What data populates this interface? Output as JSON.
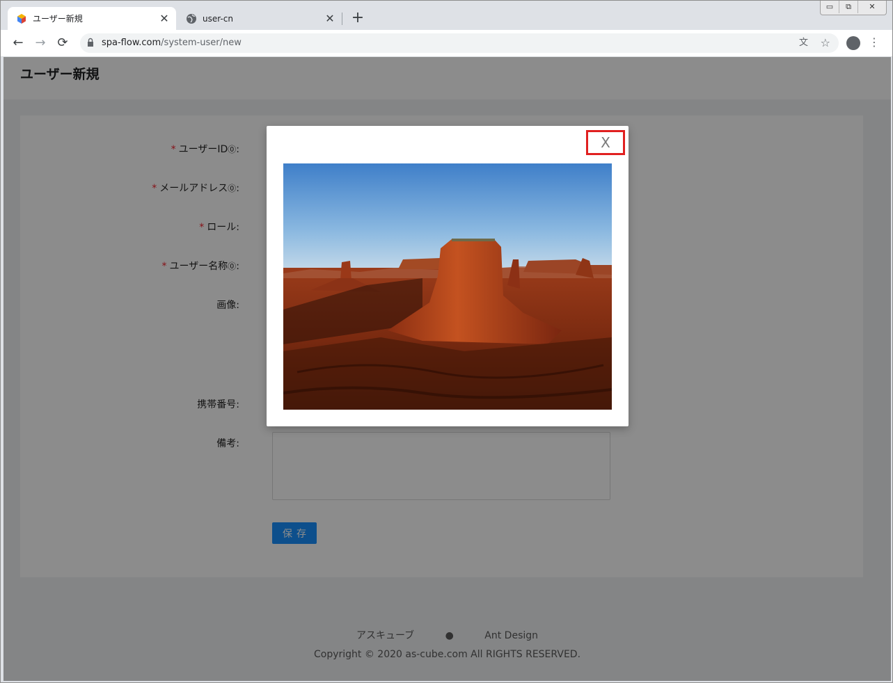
{
  "browser": {
    "tabs": [
      {
        "title": "ユーザー新規",
        "active": true,
        "favicon": "cube-icon"
      },
      {
        "title": "user-cn",
        "active": false,
        "favicon": "globe-icon"
      }
    ],
    "close_glyph": "✕",
    "new_tab_glyph": "+",
    "window_controls": {
      "minimize": "▭",
      "restore": "⧉",
      "close": "✕"
    },
    "nav": {
      "back": "←",
      "forward": "→",
      "reload": "⟳"
    },
    "url": {
      "host": "spa-flow.com",
      "path": "/system-user/new"
    },
    "star_glyph": "☆",
    "translate_glyph": "文",
    "menu_glyph": "⋮"
  },
  "page": {
    "title": "ユーザー新規",
    "form": {
      "fields": [
        {
          "label": "ユーザーID",
          "required": true,
          "help": true
        },
        {
          "label": "メールアドレス",
          "required": true,
          "help": true
        },
        {
          "label": "ロール",
          "required": true,
          "help": false
        },
        {
          "label": "ユーザー名称",
          "required": true,
          "help": true
        },
        {
          "label": "画像",
          "required": false,
          "help": false
        },
        {
          "label": "携帯番号",
          "required": false,
          "help": false
        },
        {
          "label": "備考",
          "required": false,
          "help": false
        }
      ],
      "required_mark": "*",
      "help_mark": "⓪",
      "colon": ":",
      "save_label": "保存"
    },
    "footer": {
      "link1": "アスキューブ",
      "github_glyph": "●",
      "link2": "Ant Design",
      "copyright": "Copyright © 2020 as-cube.com All RIGHTS RESERVED."
    }
  },
  "modal": {
    "close_label": "X",
    "image_subject": "desert-mesa-landscape"
  },
  "colors": {
    "primary": "#1890ff",
    "required": "#f5222d",
    "highlight_border": "#e02020"
  }
}
